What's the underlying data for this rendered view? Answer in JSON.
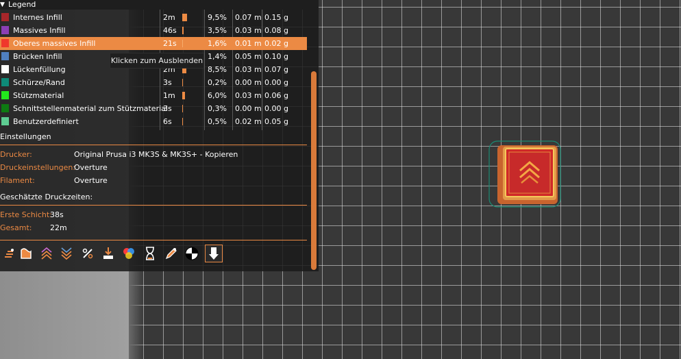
{
  "legend": {
    "title": "Legend",
    "rows": [
      {
        "name": "Internes Infill",
        "color": "#a8262a",
        "time": "2m",
        "bar_fraction": 0.55,
        "percent": "9,5%",
        "length": "0.07 m",
        "weight": "0.15 g"
      },
      {
        "name": "Massives Infill",
        "color": "#8b3fb5",
        "time": "46s",
        "bar_fraction": 0.2,
        "percent": "3,5%",
        "length": "0.03 m",
        "weight": "0.08 g"
      },
      {
        "name": "Oberes massives Infill",
        "color": "#f0382c",
        "time": "21s",
        "bar_fraction": 0.1,
        "percent": "1,6%",
        "length": "0.01 m",
        "weight": "0.02 g",
        "highlighted": true
      },
      {
        "name": "Brücken Infill",
        "color": "#4f7fbf",
        "time": "",
        "bar_fraction": 0.1,
        "percent": "1,4%",
        "length": "0.05 m",
        "weight": "0.10 g"
      },
      {
        "name": "Lückenfüllung",
        "color": "#ffffff",
        "time": "2m",
        "bar_fraction": 0.5,
        "percent": "8,5%",
        "length": "0.03 m",
        "weight": "0.07 g"
      },
      {
        "name": "Schürze/Rand",
        "color": "#0e8a78",
        "time": "3s",
        "bar_fraction": 0.02,
        "percent": "0,2%",
        "length": "0.00 m",
        "weight": "0.00 g"
      },
      {
        "name": "Stützmaterial",
        "color": "#22e81c",
        "time": "1m",
        "bar_fraction": 0.35,
        "percent": "6,0%",
        "length": "0.03 m",
        "weight": "0.06 g"
      },
      {
        "name": "Schnittstellenmaterial zum Stützmaterial",
        "color": "#0e7a12",
        "time": "3s",
        "bar_fraction": 0.02,
        "percent": "0,3%",
        "length": "0.00 m",
        "weight": "0.00 g"
      },
      {
        "name": "Benutzerdefiniert",
        "color": "#5ecc92",
        "time": "6s",
        "bar_fraction": 0.04,
        "percent": "0,5%",
        "length": "0.02 m",
        "weight": "0.05 g"
      }
    ]
  },
  "tooltip": "Klicken zum Ausblenden",
  "settings": {
    "title": "Einstellungen",
    "printer_label": "Drucker:",
    "printer_value": "Original Prusa i3 MK3S & MK3S+ - Kopieren",
    "print_settings_label": "Druckeinstellungen:",
    "print_settings_value": "Overture",
    "filament_label": "Filament:",
    "filament_value": "Overture"
  },
  "times": {
    "title": "Geschätzte Druckzeiten:",
    "first_layer_label": "Erste Schicht:",
    "first_layer_value": "38s",
    "total_label": "Gesamt:",
    "total_value": "22m"
  },
  "toolbar_icons": [
    "travel-icon",
    "wipe-icon",
    "retractions-icon",
    "deretractions-icon",
    "seams-icon",
    "tool-changes-icon",
    "color-changes-icon",
    "pause-prints-icon",
    "custom-gcode-icon",
    "center-of-gravity-icon",
    "shells-icon"
  ],
  "colors": {
    "accent": "#ec8a44",
    "panel": "#1a1a1a"
  }
}
